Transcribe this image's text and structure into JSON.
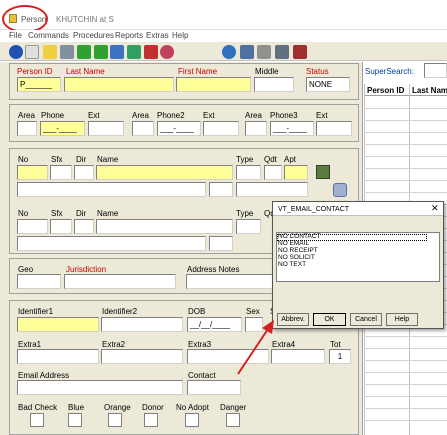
{
  "window": {
    "tab_title": "Person",
    "subtitle": "KHUTCHIN at S"
  },
  "menu": [
    "File",
    "Commands",
    "Procedures",
    "Reports",
    "Extras",
    "Help"
  ],
  "header": {
    "person_id_label": "Person ID",
    "person_id_value": "P______",
    "last_name_label": "Last Name",
    "first_name_label": "First Name",
    "middle_label": "Middle",
    "status_label": "Status",
    "status_value": "NONE"
  },
  "phones": {
    "area_label": "Area",
    "phone_label": "Phone",
    "ext_label": "Ext",
    "phone2_label": "Phone2",
    "phone3_label": "Phone3",
    "phone_mask": "___-____"
  },
  "address1": {
    "no_label": "No",
    "sfx_label": "Sfx",
    "dir_label": "Dir",
    "name_label": "Name",
    "type_label": "Type",
    "qdt_label": "Qdt",
    "apt_label": "Apt"
  },
  "address2": {
    "no_label": "No",
    "sfx_label": "Sfx",
    "dir_label": "Dir",
    "name_label": "Name",
    "type_label": "Type",
    "qdt_label": "Qdt"
  },
  "geo": {
    "geo_label": "Geo",
    "jurisdiction_label": "Jurisdiction",
    "address_notes_label": "Address Notes"
  },
  "identity": {
    "identifier1_label": "Identifier1",
    "identifier2_label": "Identifier2",
    "dob_label": "DOB",
    "dob_mask": "__/__/____",
    "sex_label": "Sex",
    "s_label": "S",
    "extra1_label": "Extra1",
    "extra2_label": "Extra2",
    "extra3_label": "Extra3",
    "extra4_label": "Extra4",
    "tot_label": "Tot",
    "tot_value": "1",
    "email_label": "Email Address",
    "contact_label": "Contact"
  },
  "flags": [
    "Bad Check",
    "Blue",
    "Orange",
    "Donor",
    "No Adopt",
    "Danger"
  ],
  "grid": {
    "supersearch_label": "SuperSearch:",
    "col_person_id": "Person ID",
    "col_last_name": "Last Nam"
  },
  "dialog": {
    "title": "VT_EMAIL_CONTACT",
    "options": [
      "NO CONTACT",
      "NO EMAIL",
      "NO RECEIPT",
      "NO SOLICIT",
      "NO TEXT"
    ],
    "btn_abbrev": "Abbrev.",
    "btn_ok": "OK",
    "btn_cancel": "Cancel",
    "btn_help": "Help"
  },
  "colors": {
    "required_field": "#ffff99",
    "label_red": "#cc0000",
    "annotation_red": "#d42020",
    "form_bg": "#ece9d8"
  }
}
